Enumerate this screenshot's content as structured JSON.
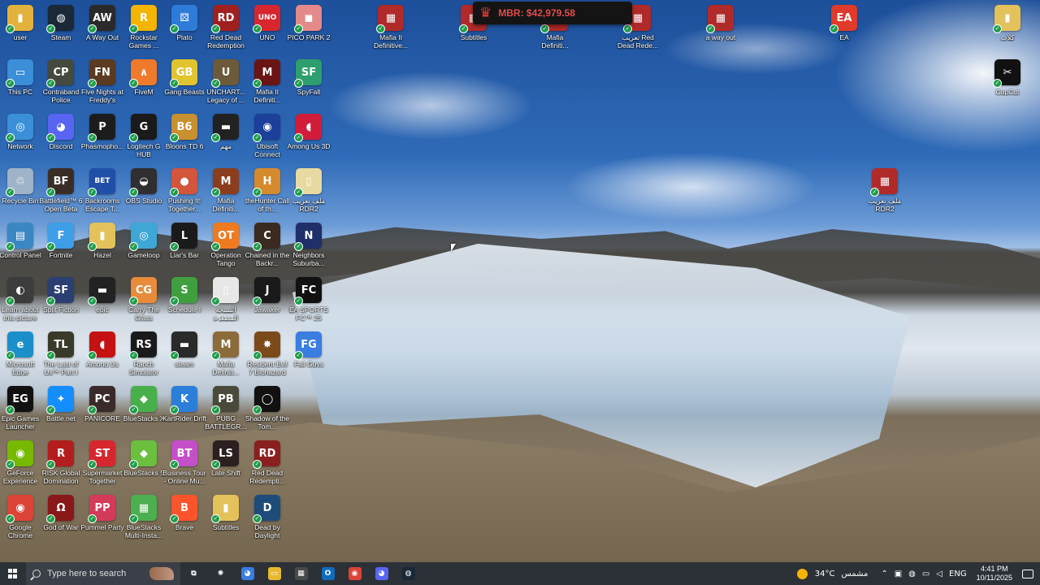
{
  "overlay": {
    "crown_icon": "crown-icon",
    "mbr_text": "MBR: $42,979.58"
  },
  "desktop_icons": {
    "c0": [
      {
        "label": "user",
        "bg": "#e3b23c",
        "glyph": "▮"
      },
      {
        "label": "This PC",
        "bg": "#3a8fd8",
        "glyph": "▭"
      },
      {
        "label": "Network",
        "bg": "#3a8fd8",
        "glyph": "◎"
      },
      {
        "label": "Recycle Bin",
        "bg": "#9fb4c9",
        "glyph": "♲"
      },
      {
        "label": "Control Panel",
        "bg": "#3b87c4",
        "glyph": "▤"
      },
      {
        "label": "Learn about this picture",
        "bg": "#3c3c3c",
        "glyph": "◐"
      },
      {
        "label": "Microsoft Edge",
        "bg": "#1b8fc9",
        "glyph": "e"
      },
      {
        "label": "Epic Games Launcher",
        "bg": "#111111",
        "glyph": "EG"
      },
      {
        "label": "GeForce Experience",
        "bg": "#76b900",
        "glyph": "◉"
      },
      {
        "label": "Google Chrome",
        "bg": "#db4437",
        "glyph": "◉"
      }
    ],
    "c1": [
      {
        "label": "Steam",
        "bg": "#1b2838",
        "glyph": "◍"
      },
      {
        "label": "Contraband Police",
        "bg": "#444b3e",
        "glyph": "CP"
      },
      {
        "label": "Discord",
        "bg": "#5865f2",
        "glyph": "◕"
      },
      {
        "label": "Battlefield™ 6 Open Beta",
        "bg": "#3a2d27",
        "glyph": "BF"
      },
      {
        "label": "Fortnite",
        "bg": "#3e9ee8",
        "glyph": "F"
      },
      {
        "label": "Split Fiction",
        "bg": "#2b3f73",
        "glyph": "SF"
      },
      {
        "label": "The Last of Us™ Part I",
        "bg": "#3a3a2a",
        "glyph": "TL"
      },
      {
        "label": "Battle.net",
        "bg": "#148eff",
        "glyph": "✦"
      },
      {
        "label": "RISK Global Domination",
        "bg": "#b41d1d",
        "glyph": "R"
      },
      {
        "label": "God of War",
        "bg": "#8a1818",
        "glyph": "Ω"
      }
    ],
    "c2": [
      {
        "label": "A Way Out",
        "bg": "#2a2a2a",
        "glyph": "AW"
      },
      {
        "label": "Five Nights at Freddy's",
        "bg": "#5a3a20",
        "glyph": "FN"
      },
      {
        "label": "Phasmopho...",
        "bg": "#1c1c1c",
        "glyph": "P"
      },
      {
        "label": "Backrooms Escape T...",
        "bg": "#1f4fa6",
        "glyph": "BET"
      },
      {
        "label": "Hazel",
        "bg": "#e3c25c",
        "glyph": "▮"
      },
      {
        "label": "epic",
        "bg": "#222222",
        "glyph": "▬"
      },
      {
        "label": "Among Us",
        "bg": "#c51111",
        "glyph": "◖"
      },
      {
        "label": "PANICORE",
        "bg": "#3a2a2a",
        "glyph": "PC"
      },
      {
        "label": "Supermarket Together",
        "bg": "#d8262e",
        "glyph": "ST"
      },
      {
        "label": "Pummel Party",
        "bg": "#d43a5a",
        "glyph": "PP"
      }
    ],
    "c3": [
      {
        "label": "Rockstar Games ...",
        "bg": "#f4b400",
        "glyph": "R"
      },
      {
        "label": "FiveM",
        "bg": "#f07a2b",
        "glyph": "∧"
      },
      {
        "label": "Logitech G HUB",
        "bg": "#1a1a1a",
        "glyph": "G"
      },
      {
        "label": "OBS Studio",
        "bg": "#302e31",
        "glyph": "◒"
      },
      {
        "label": "Gameloop",
        "bg": "#3fa7d6",
        "glyph": "◎"
      },
      {
        "label": "Carry The Glass",
        "bg": "#e88b3a",
        "glyph": "CG"
      },
      {
        "label": "Ranch Simulator",
        "bg": "#1a1a1a",
        "glyph": "RS"
      },
      {
        "label": "BlueStacks X",
        "bg": "#47b04b",
        "glyph": "◆"
      },
      {
        "label": "BlueStacks 5",
        "bg": "#6abf3f",
        "glyph": "◆"
      },
      {
        "label": "BlueStacks Multi-Insta...",
        "bg": "#4caf50",
        "glyph": "▦"
      }
    ],
    "c4": [
      {
        "label": "Plato",
        "bg": "#2f7bd8",
        "glyph": "⚄"
      },
      {
        "label": "Gang Beasts",
        "bg": "#e2c42f",
        "glyph": "GB"
      },
      {
        "label": "Bloons TD 6",
        "bg": "#c9902f",
        "glyph": "B6"
      },
      {
        "label": "Pushing It! Together...",
        "bg": "#d2553c",
        "glyph": "●"
      },
      {
        "label": "Liar's Bar",
        "bg": "#1a1a1a",
        "glyph": "L"
      },
      {
        "label": "Schedule I",
        "bg": "#3f9f3f",
        "glyph": "S"
      },
      {
        "label": "steam",
        "bg": "#2a2a2a",
        "glyph": "▬"
      },
      {
        "label": "KartRider Drift",
        "bg": "#2c7fd8",
        "glyph": "K"
      },
      {
        "label": "Business Tour - Online Mu...",
        "bg": "#c44fc9",
        "glyph": "BT"
      },
      {
        "label": "Brave",
        "bg": "#fb542b",
        "glyph": "B"
      }
    ],
    "c5": [
      {
        "label": "Red Dead Redemption",
        "bg": "#a01f1f",
        "glyph": "RD"
      },
      {
        "label": "UNCHART... Legacy of ...",
        "bg": "#6d5a3a",
        "glyph": "U"
      },
      {
        "label": "مهم",
        "bg": "#222222",
        "glyph": "▬"
      },
      {
        "label": "Mafia Definiti...",
        "bg": "#8a3e1e",
        "glyph": "M"
      },
      {
        "label": "Operation Tango",
        "bg": "#f07a20",
        "glyph": "OT"
      },
      {
        "label": "النسخة المصغرة",
        "bg": "#e7e7e7",
        "glyph": "▯"
      },
      {
        "label": "Mafia Definiti...",
        "bg": "#8b6b3a",
        "glyph": "M"
      },
      {
        "label": "PUBG BATTLEGR...",
        "bg": "#4a4a3a",
        "glyph": "PB"
      },
      {
        "label": "Late Shift",
        "bg": "#2c1f1f",
        "glyph": "LS"
      },
      {
        "label": "Subtitles",
        "bg": "#e3c25c",
        "glyph": "▮"
      }
    ],
    "c6": [
      {
        "label": "UNO",
        "bg": "#d8262e",
        "glyph": "UNO"
      },
      {
        "label": "Mafia II Definiti...",
        "bg": "#6a1414",
        "glyph": "M"
      },
      {
        "label": "Ubisoft Connect",
        "bg": "#1c3f99",
        "glyph": "◉"
      },
      {
        "label": "theHunter Call of th...",
        "bg": "#d68a2e",
        "glyph": "H"
      },
      {
        "label": "Chained in the Backr...",
        "bg": "#3a2a1f",
        "glyph": "C"
      },
      {
        "label": "Jawaker",
        "bg": "#1a1a1a",
        "glyph": "J"
      },
      {
        "label": "Resident Evil 7 Biohazard",
        "bg": "#7a4a1a",
        "glyph": "✸"
      },
      {
        "label": "Shadow of the Tom...",
        "bg": "#111111",
        "glyph": "◯"
      },
      {
        "label": "Red Dead Redempti...",
        "bg": "#8a1f1f",
        "glyph": "RD"
      },
      {
        "label": "Dead by Daylight",
        "bg": "#1e4c7a",
        "glyph": "D"
      }
    ],
    "c7": [
      {
        "label": "PICO PARK 2",
        "bg": "#e58a8a",
        "glyph": "◼"
      },
      {
        "label": "SpyFall",
        "bg": "#2f9e6f",
        "glyph": "SF"
      },
      {
        "label": "Among Us 3D",
        "bg": "#d11c3a",
        "glyph": "◖"
      },
      {
        "label": "ملف تعريب RDR2",
        "bg": "#e8d9a0",
        "glyph": "▯"
      },
      {
        "label": "Neighbors Suburba...",
        "bg": "#1f2f6a",
        "glyph": "N"
      },
      {
        "label": "EA SPORTS FC™ 25",
        "bg": "#111111",
        "glyph": "FC"
      },
      {
        "label": "Fall Guys",
        "bg": "#3b7de0",
        "glyph": "FG"
      }
    ],
    "top": [
      {
        "label": "Mafia II Definitive...",
        "bg": "#b02a2a",
        "glyph": "▦"
      },
      {
        "label": "Subtitles",
        "bg": "#b02a2a",
        "glyph": "▦"
      },
      {
        "label": "Mafia Definiti...",
        "bg": "#b02a2a",
        "glyph": "▦"
      },
      {
        "label": "تعريب Red Dead Rede...",
        "bg": "#b02a2a",
        "glyph": "▦"
      },
      {
        "label": "a way out",
        "bg": "#b02a2a",
        "glyph": "▦"
      },
      {
        "label": "EA",
        "bg": "#e03a2a",
        "glyph": "EA"
      }
    ],
    "right": [
      {
        "label": "كلاب",
        "bg": "#e3c25c",
        "glyph": "▮"
      },
      {
        "label": "CapCut",
        "bg": "#111111",
        "glyph": "✂"
      },
      {
        "label": "ملف تعريب RDR2",
        "bg": "#b02a2a",
        "glyph": "▦"
      }
    ]
  },
  "taskbar": {
    "search_placeholder": "Type here to search",
    "pinned": [
      {
        "name": "task-view-icon",
        "glyph": "⧉",
        "bg": "transparent"
      },
      {
        "name": "copilot-icon",
        "glyph": "✺",
        "bg": "transparent"
      },
      {
        "name": "copilot-app-icon",
        "glyph": "◕",
        "bg": "#3a7de0"
      },
      {
        "name": "file-explorer-icon",
        "glyph": "▭",
        "bg": "#e8b931"
      },
      {
        "name": "calculator-icon",
        "glyph": "▦",
        "bg": "#4a4a4a"
      },
      {
        "name": "outlook-icon",
        "glyph": "O",
        "bg": "#0f6cbd"
      },
      {
        "name": "chrome-icon",
        "glyph": "◉",
        "bg": "#db4437"
      },
      {
        "name": "discord-icon",
        "glyph": "◕",
        "bg": "#5865f2"
      },
      {
        "name": "steam-icon",
        "glyph": "◍",
        "bg": "#1b2838"
      }
    ],
    "weather": {
      "temp": "34°C",
      "condition": "مشمس"
    },
    "language": "ENG",
    "time": "4:41 PM",
    "date": "10/11/2025"
  }
}
